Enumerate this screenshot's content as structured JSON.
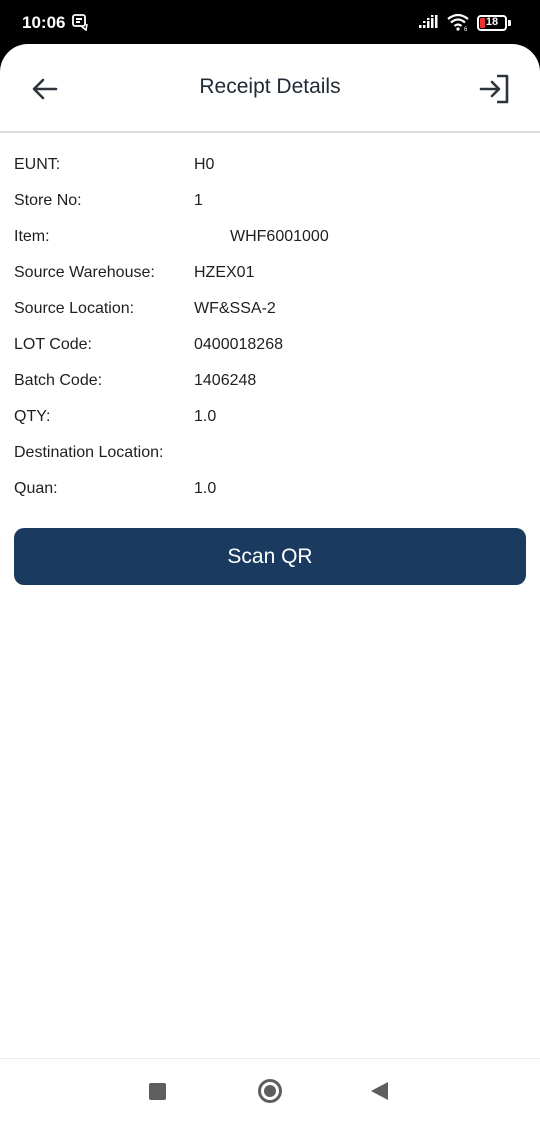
{
  "status_bar": {
    "time": "10:06",
    "battery_level": "18",
    "icons": [
      "notification-icon",
      "signal-icon",
      "wifi-icon",
      "battery-icon"
    ]
  },
  "header": {
    "title": "Receipt Details",
    "back_icon": "arrow-left-icon",
    "logout_icon": "logout-icon"
  },
  "details": [
    {
      "label": "EUNT:",
      "value": "H0"
    },
    {
      "label": "Store No:",
      "value": "1"
    },
    {
      "label": "Item:",
      "value": "WHF6001000"
    },
    {
      "label": "Source Warehouse:",
      "value": "HZEX01"
    },
    {
      "label": "Source Location:",
      "value": "WF&SSA-2"
    },
    {
      "label": "LOT Code:",
      "value": "0400018268"
    },
    {
      "label": "Batch Code:",
      "value": "1406248"
    },
    {
      "label": "QTY:",
      "value": "1.0"
    },
    {
      "label": "Destination Location:",
      "value": ""
    },
    {
      "label": "Quan:",
      "value": "1.0"
    }
  ],
  "actions": {
    "scan_label": "Scan QR"
  },
  "colors": {
    "primary": "#1a3a5f",
    "battery_low": "#e33333",
    "text": "#1f1f1f"
  }
}
